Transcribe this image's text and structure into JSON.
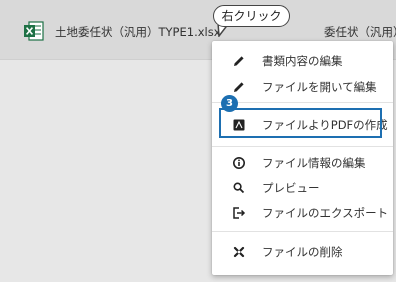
{
  "file_row": {
    "file_name": "土地委任状（汎用）TYPE1.xlsx",
    "type": "委任状（汎用）",
    "file_icon": "excel-file-icon"
  },
  "callout": {
    "text": "右クリック"
  },
  "step": {
    "number": "3"
  },
  "context_menu": {
    "items": [
      {
        "label": "書類内容の編集",
        "icon": "pencil-icon"
      },
      {
        "label": "ファイルを開いて編集",
        "icon": "pencil-icon"
      },
      {
        "label": "ファイルよりPDFの作成",
        "icon": "pdf-icon"
      },
      {
        "label": "ファイル情報の編集",
        "icon": "info-icon"
      },
      {
        "label": "プレビュー",
        "icon": "search-icon"
      },
      {
        "label": "ファイルのエクスポート",
        "icon": "export-icon"
      },
      {
        "label": "ファイルの削除",
        "icon": "delete-icon"
      }
    ]
  },
  "colors": {
    "accent": "#1d6fb1",
    "excel_green": "#1e7145"
  }
}
